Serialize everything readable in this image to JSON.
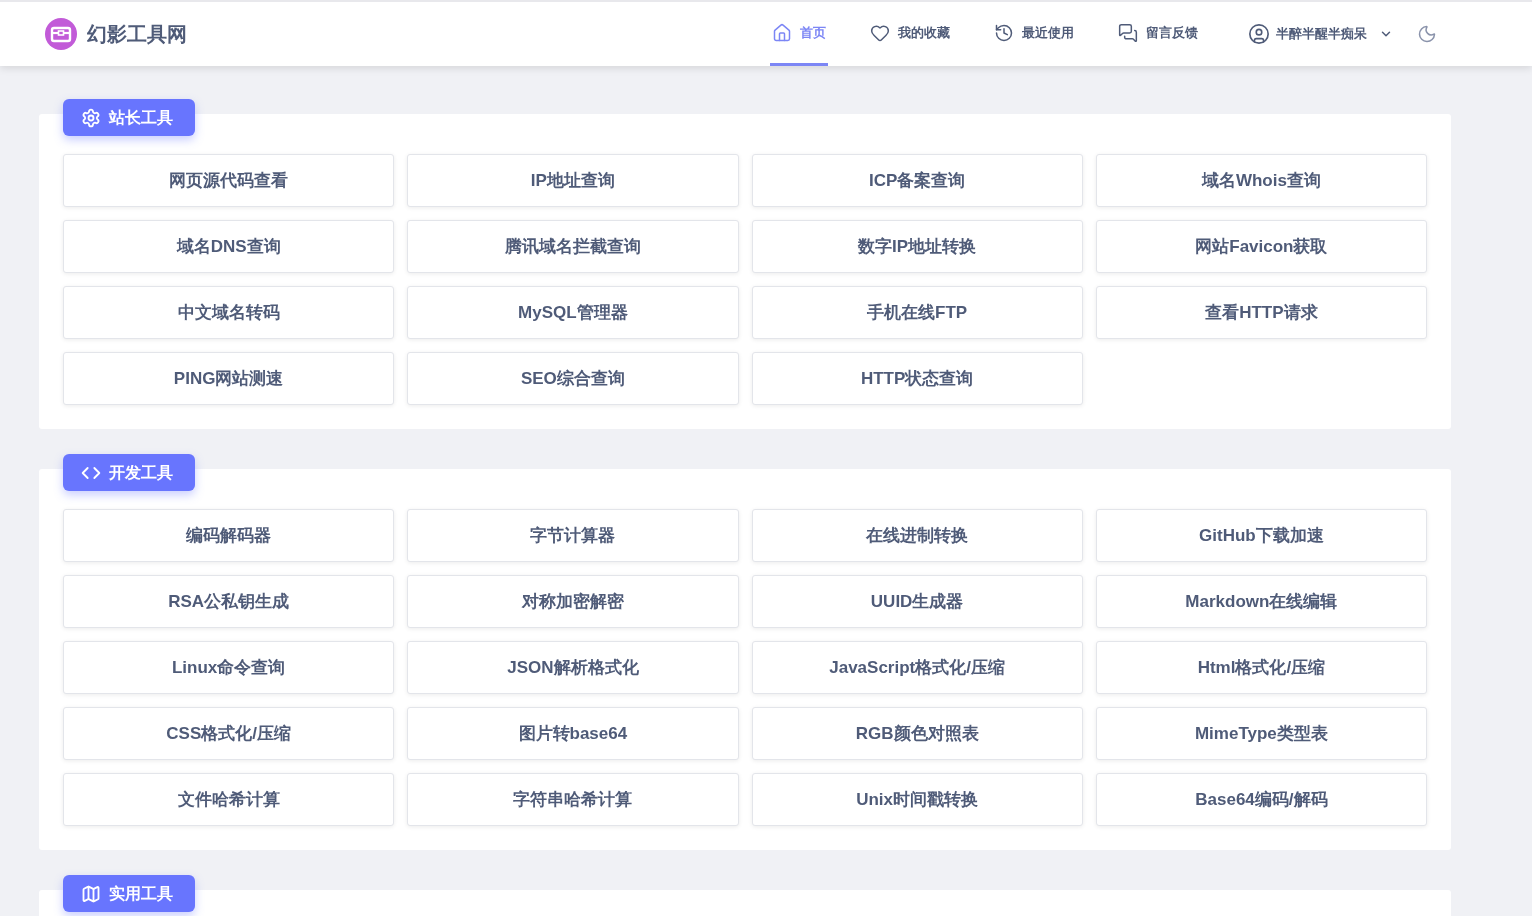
{
  "site": {
    "title": "幻影工具网"
  },
  "nav": [
    {
      "label": "首页",
      "selected": true
    },
    {
      "label": "我的收藏",
      "selected": false
    },
    {
      "label": "最近使用",
      "selected": false
    },
    {
      "label": "留言反馈",
      "selected": false
    }
  ],
  "user": {
    "name": "半醉半醒半痴呆"
  },
  "sections": [
    {
      "title": "站长工具",
      "tools": [
        "网页源代码查看",
        "IP地址查询",
        "ICP备案查询",
        "域名Whois查询",
        "域名DNS查询",
        "腾讯域名拦截查询",
        "数字IP地址转换",
        "网站Favicon获取",
        "中文域名转码",
        "MySQL管理器",
        "手机在线FTP",
        "查看HTTP请求",
        "PING网站测速",
        "SEO综合查询",
        "HTTP状态查询"
      ]
    },
    {
      "title": "开发工具",
      "tools": [
        "编码解码器",
        "字节计算器",
        "在线进制转换",
        "GitHub下载加速",
        "RSA公私钥生成",
        "对称加密解密",
        "UUID生成器",
        "Markdown在线编辑",
        "Linux命令查询",
        "JSON解析格式化",
        "JavaScript格式化/压缩",
        "Html格式化/压缩",
        "CSS格式化/压缩",
        "图片转base64",
        "RGB颜色对照表",
        "MimeType类型表",
        "文件哈希计算",
        "字符串哈希计算",
        "Unix时间戳转换",
        "Base64编码/解码"
      ]
    },
    {
      "title": "实用工具"
    }
  ]
}
